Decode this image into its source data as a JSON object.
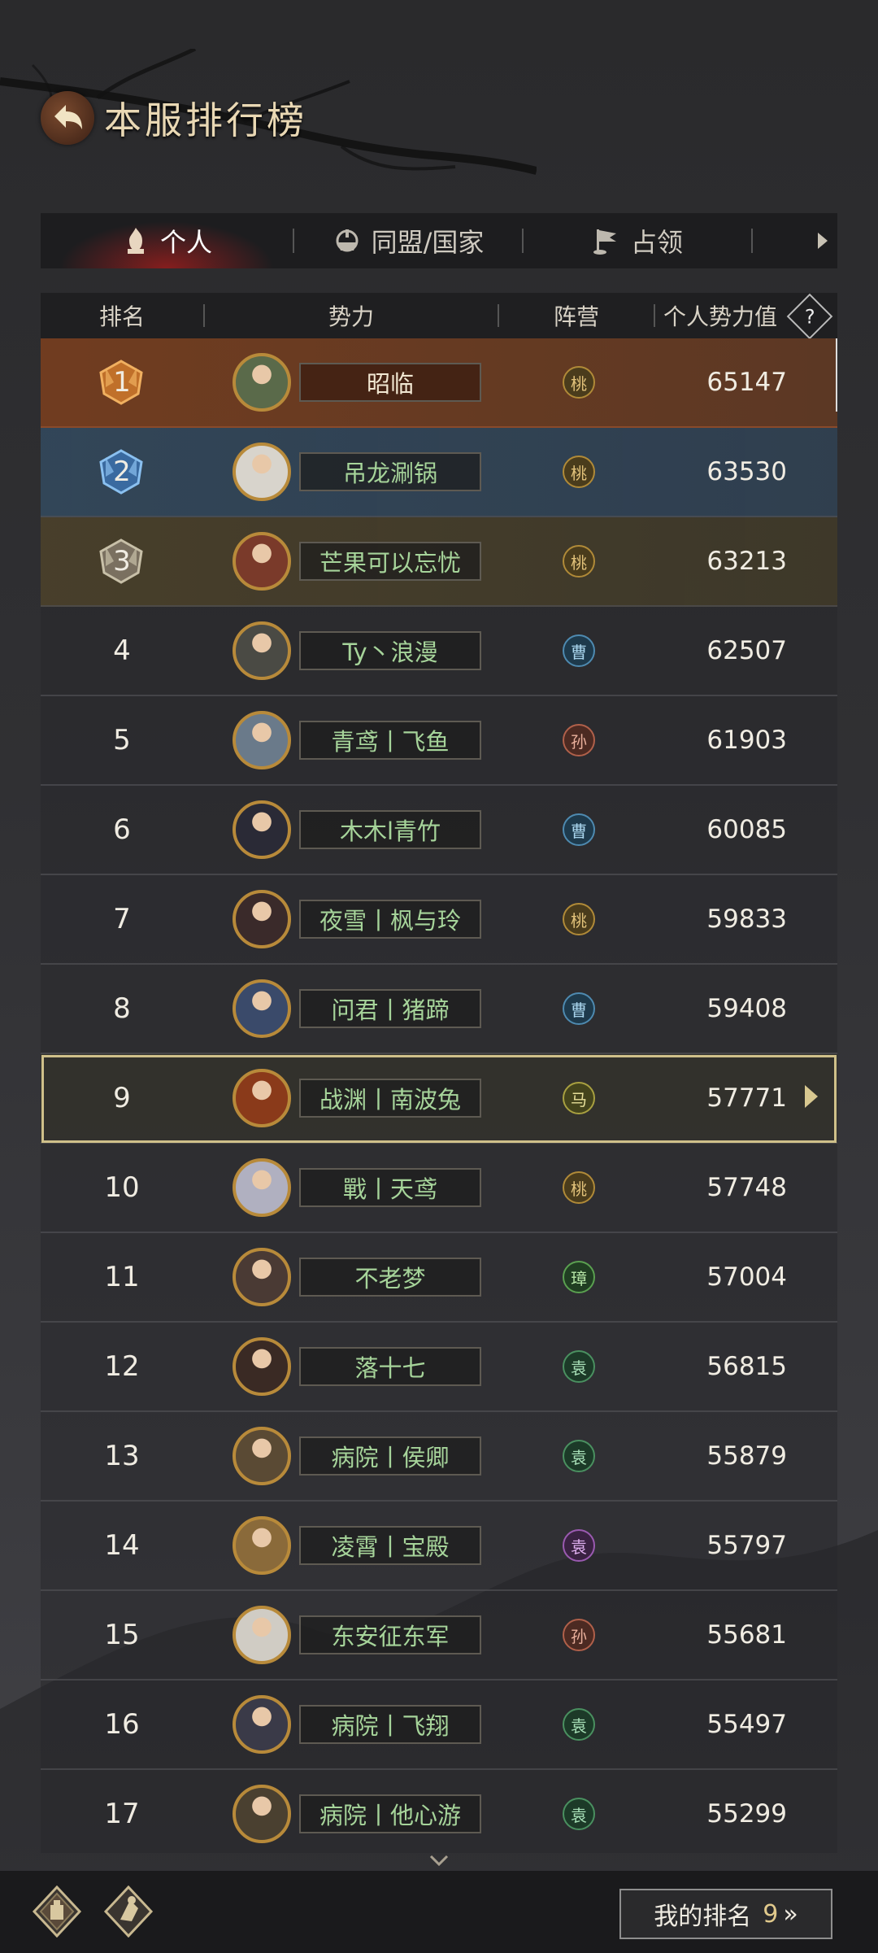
{
  "header": {
    "title": "本服排行榜"
  },
  "tabs": [
    {
      "label": "个人",
      "icon": "person-flame-icon",
      "active": true
    },
    {
      "label": "同盟/国家",
      "icon": "alliance-helmet-icon",
      "active": false
    },
    {
      "label": "占领",
      "icon": "flag-icon",
      "active": false
    }
  ],
  "table": {
    "headers": [
      "排名",
      "势力",
      "阵营",
      "个人势力值"
    ],
    "rows": [
      {
        "rank": "1",
        "name": "昭临",
        "camp": "桃",
        "campType": "tao",
        "power": "65147",
        "avatarColor": "#5a6a4a"
      },
      {
        "rank": "2",
        "name": "吊龙涮锅",
        "camp": "桃",
        "campType": "tao",
        "power": "63530",
        "avatarColor": "#d8d4cc"
      },
      {
        "rank": "3",
        "name": "芒果可以忘忧",
        "camp": "桃",
        "campType": "tao",
        "power": "63213",
        "avatarColor": "#7a3a2a"
      },
      {
        "rank": "4",
        "name": "Ty丶浪漫",
        "camp": "曹",
        "campType": "cao",
        "power": "62507",
        "avatarColor": "#4a4a44"
      },
      {
        "rank": "5",
        "name": "青鸢丨飞鱼",
        "camp": "孙",
        "campType": "sun",
        "power": "61903",
        "avatarColor": "#6a7a8a"
      },
      {
        "rank": "6",
        "name": "木木l青竹",
        "camp": "曹",
        "campType": "cao",
        "power": "60085",
        "avatarColor": "#2a2a36"
      },
      {
        "rank": "7",
        "name": "夜雪丨枫与玲",
        "camp": "桃",
        "campType": "tao",
        "power": "59833",
        "avatarColor": "#3a2a2a"
      },
      {
        "rank": "8",
        "name": "问君丨猪蹄",
        "camp": "曹",
        "campType": "cao",
        "power": "59408",
        "avatarColor": "#3a4a6a"
      },
      {
        "rank": "9",
        "name": "战渊丨南波兔",
        "camp": "马",
        "campType": "ma",
        "power": "57771",
        "avatarColor": "#8a3a1a"
      },
      {
        "rank": "10",
        "name": "戰丨天鸢",
        "camp": "桃",
        "campType": "tao",
        "power": "57748",
        "avatarColor": "#b0b0c0"
      },
      {
        "rank": "11",
        "name": "不老梦",
        "camp": "璋",
        "campType": "zhang",
        "power": "57004",
        "avatarColor": "#4a3a34"
      },
      {
        "rank": "12",
        "name": "落十七",
        "camp": "袁",
        "campType": "yuan",
        "power": "56815",
        "avatarColor": "#3a2a24"
      },
      {
        "rank": "13",
        "name": "病院丨侯卿",
        "camp": "袁",
        "campType": "yuan",
        "power": "55879",
        "avatarColor": "#5a4a34"
      },
      {
        "rank": "14",
        "name": "凌霄丨宝殿",
        "camp": "袁",
        "campType": "yuan2",
        "power": "55797",
        "avatarColor": "#8a6a3a"
      },
      {
        "rank": "15",
        "name": "东安征东军",
        "camp": "孙",
        "campType": "sun",
        "power": "55681",
        "avatarColor": "#d0ccc4"
      },
      {
        "rank": "16",
        "name": "病院丨飞翔",
        "camp": "袁",
        "campType": "yuan",
        "power": "55497",
        "avatarColor": "#3a3a48"
      },
      {
        "rank": "17",
        "name": "病院丨他心游",
        "camp": "袁",
        "campType": "yuan",
        "power": "55299",
        "avatarColor": "#4a4030"
      }
    ]
  },
  "myRank": {
    "label": "我的排名",
    "value": "9",
    "chevron": "»"
  },
  "colors": {
    "rank1": "#7a3e1e",
    "rank2": "#30485c",
    "rank3": "#4a402a",
    "nameGreen": "#a6d49a",
    "highlight": "#cfc08a"
  }
}
